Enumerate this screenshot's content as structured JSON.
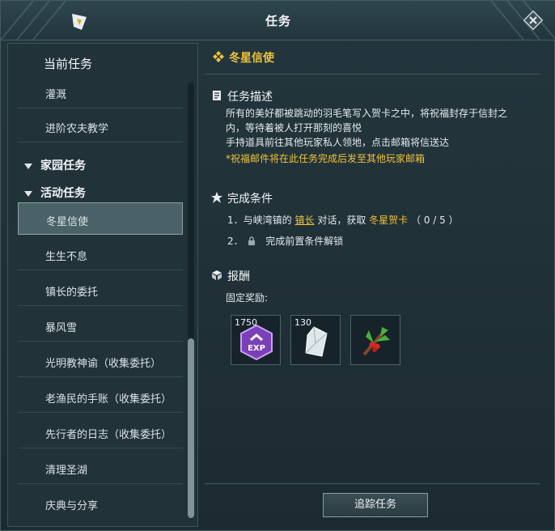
{
  "window": {
    "title": "任务"
  },
  "sidebar": {
    "current_header": "当前任务",
    "items_top": [
      {
        "label": "灌溉"
      },
      {
        "label": "进阶农夫教学"
      }
    ],
    "groups": [
      {
        "label": "家园任务"
      },
      {
        "label": "活动任务"
      }
    ],
    "items": [
      {
        "label": "冬星信使",
        "active": true
      },
      {
        "label": "生生不息"
      },
      {
        "label": "镇长的委托"
      },
      {
        "label": "暴风雪"
      },
      {
        "label": "光明教神谕（收集委托）"
      },
      {
        "label": "老渔民的手账（收集委托）"
      },
      {
        "label": "先行者的日志（收集委托）"
      },
      {
        "label": "清理圣湖"
      },
      {
        "label": "庆典与分享"
      }
    ]
  },
  "quest": {
    "title": "冬星信使",
    "desc_header": "任务描述",
    "desc_lines": [
      "所有的美好都被跳动的羽毛笔写入贺卡之中，将祝福封存于信封之",
      "内，等待着被人打开那刻的喜悦",
      "手持道具前往其他玩家私人领地，点击邮箱将信送达"
    ],
    "desc_note": "*祝福邮件将在此任务完成后发至其他玩家邮箱",
    "cond_header": "完成条件",
    "cond1": {
      "prefix": "1．与峡湾镇的",
      "npc": "镇长",
      "mid": "对话，获取",
      "item": "冬星贺卡",
      "progress": "（ 0 / 5 ）"
    },
    "cond2": {
      "num": "2．",
      "text": "完成前置条件解锁"
    },
    "reward_header": "报酬",
    "reward_sub": "固定奖励:",
    "rewards": [
      {
        "count": "1750",
        "icon": "exp-icon"
      },
      {
        "count": "130",
        "icon": "crystal-icon"
      },
      {
        "count": "",
        "icon": "holly-branch-icon"
      }
    ],
    "track_button": "追踪任务"
  },
  "colors": {
    "accent": "#f0c23c",
    "bg": "#1d2a30",
    "panel": "#213239"
  }
}
